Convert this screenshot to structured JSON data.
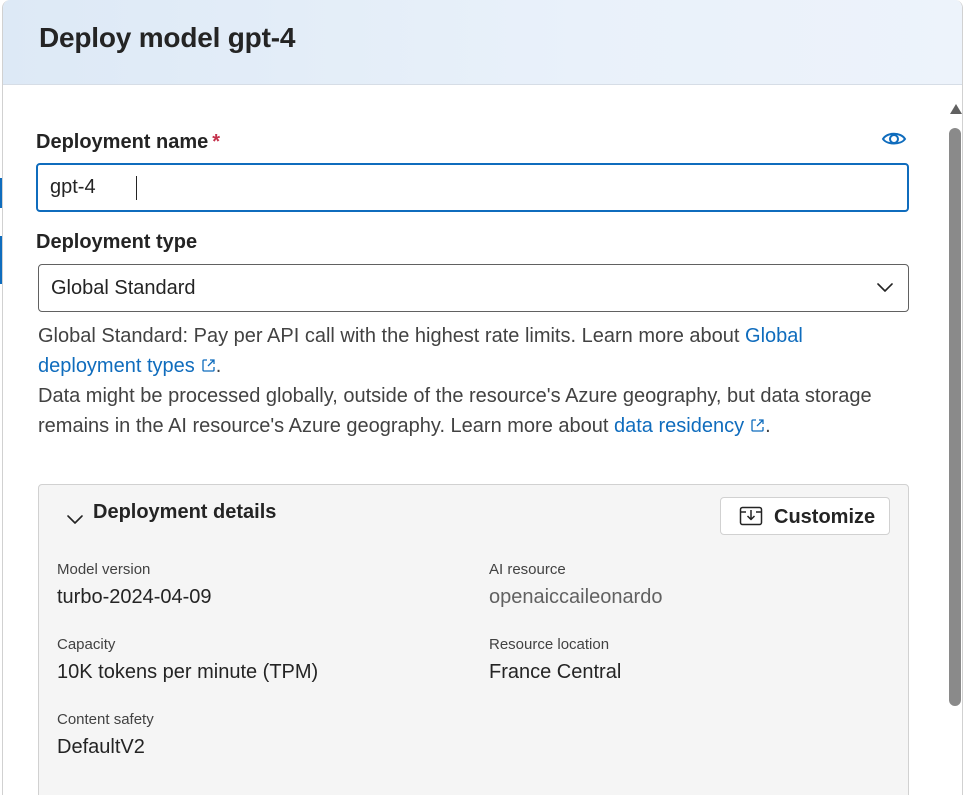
{
  "dialog": {
    "title": "Deploy model gpt-4"
  },
  "deployment_name": {
    "label": "Deployment name",
    "required_mark": "*",
    "value": "gpt-4",
    "icon": "eye-icon"
  },
  "deployment_type": {
    "label": "Deployment type",
    "selected": "Global Standard",
    "icon": "chevron-down-icon"
  },
  "info": {
    "line1_text": "Global Standard: Pay per API call with the highest rate limits. Learn more about ",
    "line1_link": "Global deployment types",
    "line1_end": ".",
    "line2_text": "Data might be processed globally, outside of the resource's Azure geography, but data storage remains in the AI resource's Azure geography. Learn more about ",
    "line2_link": "data residency",
    "line2_end": "."
  },
  "details": {
    "title": "Deployment details",
    "customize_label": "Customize",
    "customize_icon": "customize-icon",
    "model_version_label": "Model version",
    "model_version_value": "turbo-2024-04-09",
    "ai_resource_label": "AI resource",
    "ai_resource_value": "openaiccaileonardo",
    "capacity_label": "Capacity",
    "capacity_value": "10K tokens per minute (TPM)",
    "resource_location_label": "Resource location",
    "resource_location_value": "France Central",
    "content_safety_label": "Content safety",
    "content_safety_value": "DefaultV2"
  },
  "colors": {
    "accent": "#0f6cbd",
    "required": "#c4314b",
    "header_bg": "#e3edf8",
    "card_bg": "#f5f5f5"
  }
}
